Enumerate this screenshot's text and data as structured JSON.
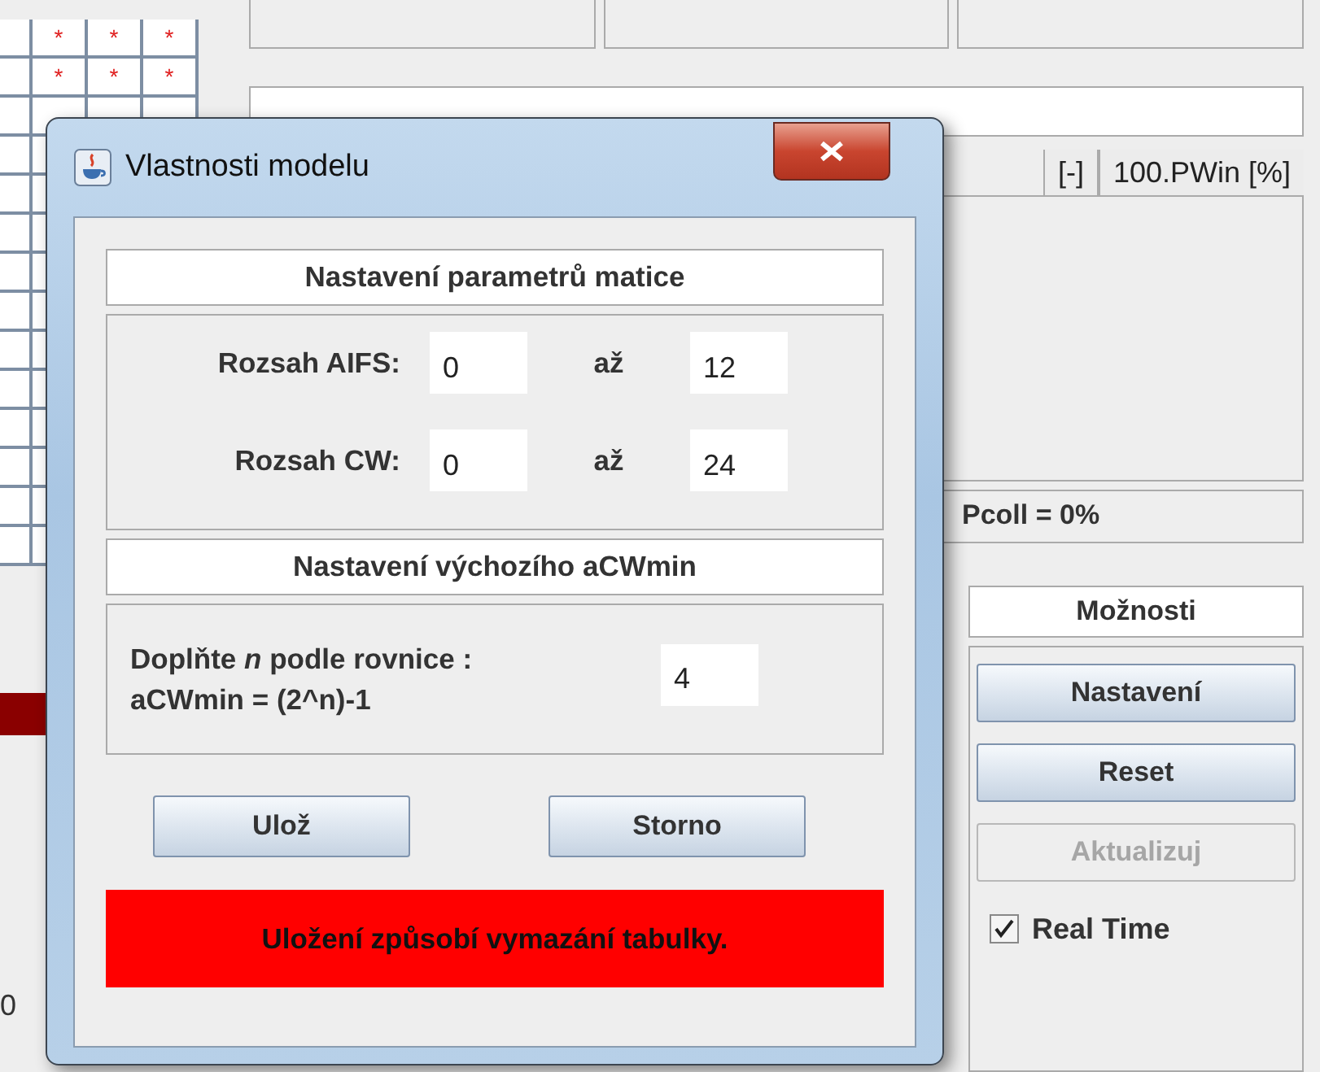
{
  "background": {
    "grid_rows": [
      [
        "*",
        "*",
        "*"
      ],
      [
        "*",
        "*",
        "*"
      ]
    ],
    "table_header": [
      "[-]",
      "100.PWin [%]"
    ],
    "status": "Pcoll = 0%",
    "options": {
      "title": "Možnosti",
      "buttons": [
        {
          "label": "Nastavení",
          "disabled": false
        },
        {
          "label": "Reset",
          "disabled": false
        },
        {
          "label": "Aktualizuj",
          "disabled": true
        }
      ],
      "real_time": {
        "label": "Real Time",
        "checked": true
      }
    },
    "edge_value": "0"
  },
  "dialog": {
    "title": "Vlastnosti modelu",
    "matrix": {
      "title": "Nastavení parametrů matice",
      "rows": [
        {
          "label": "Rozsah AIFS:",
          "from": "0",
          "separator": "až",
          "to": "12"
        },
        {
          "label": "Rozsah CW:",
          "from": "0",
          "separator": "až",
          "to": "24"
        }
      ]
    },
    "default": {
      "title": "Nastavení výchozího aCWmin",
      "lines": [
        "Doplňte *n* podle rovnice :",
        "aCWmin = (2^n)-1"
      ],
      "value": "4"
    },
    "buttons": [
      "Ulož",
      "Storno"
    ],
    "warning": "Uložení způsobí vymazání tabulky."
  }
}
